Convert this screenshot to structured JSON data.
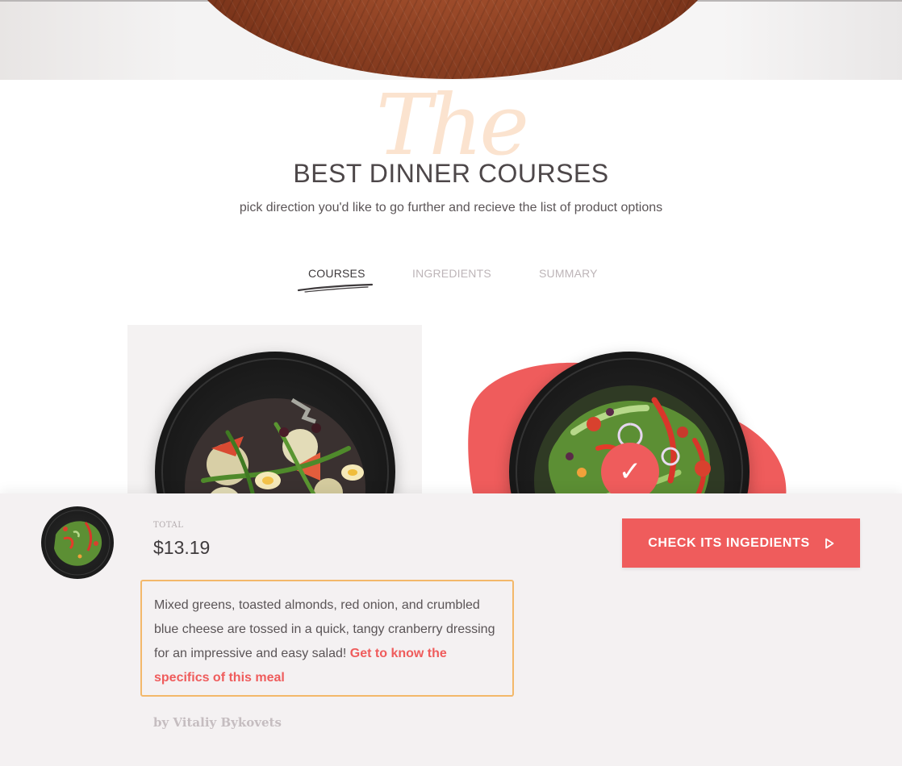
{
  "header": {
    "script_word": "The",
    "title": "BEST DINNER COURSES",
    "subtitle": "pick direction you'd like to go further and recieve the list of product options"
  },
  "tabs": [
    {
      "label": "COURSES",
      "active": true
    },
    {
      "label": "INGREDIENTS",
      "active": false
    },
    {
      "label": "SUMMARY",
      "active": false
    }
  ],
  "courses": [
    {
      "name": "nicoise-salad",
      "selected": false
    },
    {
      "name": "green-salad",
      "selected": true,
      "badge_icon": "check-icon"
    }
  ],
  "summary": {
    "total_label": "TOTAL",
    "total_value": "$13.19",
    "cta_label": "CHECK ITS INGEDIENTS",
    "cta_icon": "play-outline-icon",
    "description": "Mixed greens, toasted almonds, red onion, and crumbled blue cheese are tossed in a quick, tangy cranberry dressing for an impressive and easy salad! ",
    "description_link": "Get to know the specifics of this meal",
    "byline": "by Vitaliy Bykovets"
  },
  "colors": {
    "accent": "#ef5c5c",
    "border_highlight": "#f3b86a",
    "script": "#fbe3cf",
    "panel_bg": "#f4f1f2"
  }
}
